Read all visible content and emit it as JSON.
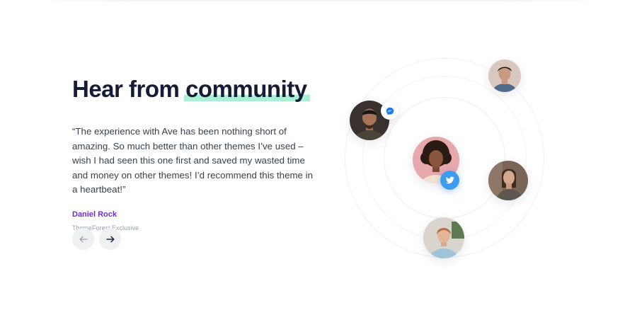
{
  "section": {
    "heading_prefix": "Hear from",
    "heading_highlight": "community",
    "quote": "“The experience with Ave has been nothing short of amazing. So much better than other themes I’ve used – wish I had seen this one first and saved my wasted time and money on other themes! I’d recommend this theme in a heartbeat!”",
    "author_name": "Daniel Rock",
    "author_role": "ThemeForest Exclusive"
  },
  "controls": {
    "prev_icon": "arrow-left-icon",
    "next_icon": "arrow-right-icon"
  },
  "badges": {
    "messenger_icon": "messenger-icon",
    "twitter_icon": "twitter-icon"
  },
  "colors": {
    "heading": "#171c36",
    "highlight": "#a8efd3",
    "author": "#6f2bd8",
    "role": "#9aa1b1",
    "twitter": "#3e9cf0",
    "messenger": "#1d7cf2"
  }
}
